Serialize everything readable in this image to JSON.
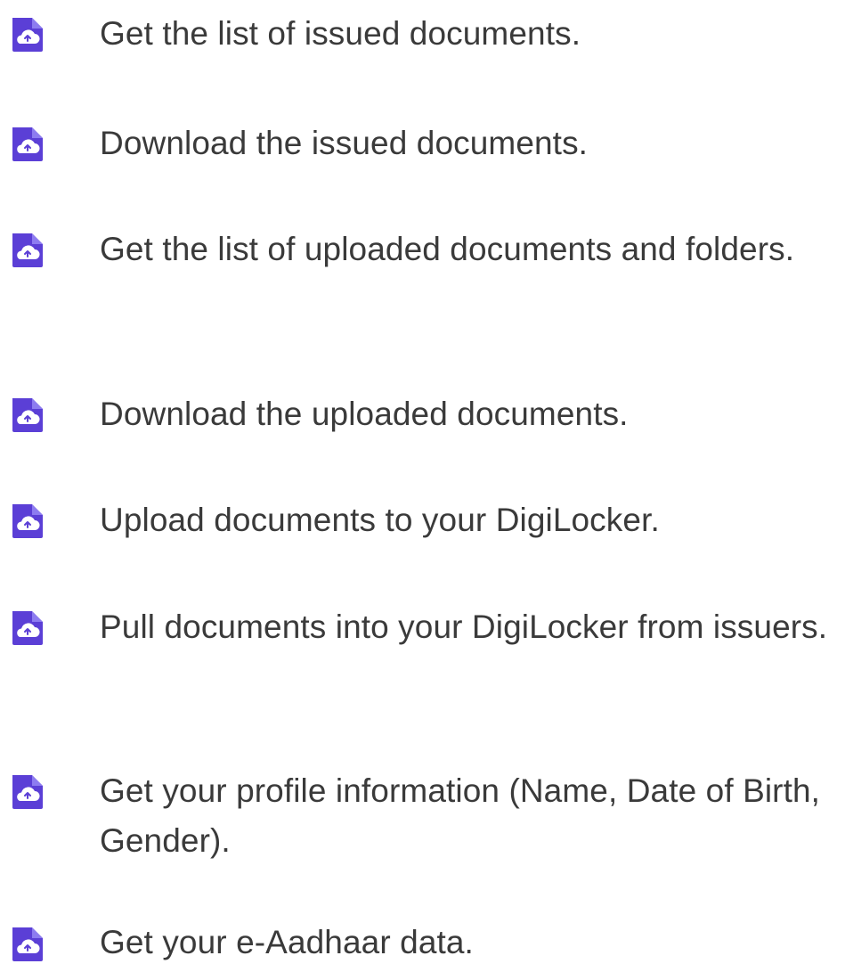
{
  "permissions": {
    "icon": "cloud-document-icon",
    "icon_colors": {
      "primary": "#5b3fd6",
      "secondary": "#7d6ce8",
      "accent": "#ffffff"
    },
    "items": [
      {
        "label": "Get the list of issued documents."
      },
      {
        "label": "Download the issued documents."
      },
      {
        "label": "Get the list of uploaded documents and folders."
      },
      {
        "label": "Download the uploaded documents."
      },
      {
        "label": "Upload documents to your DigiLocker."
      },
      {
        "label": "Pull documents into your DigiLocker from issuers."
      },
      {
        "label": "Get your profile information (Name, Date of Birth, Gender)."
      },
      {
        "label": "Get your e-Aadhaar data."
      }
    ]
  }
}
